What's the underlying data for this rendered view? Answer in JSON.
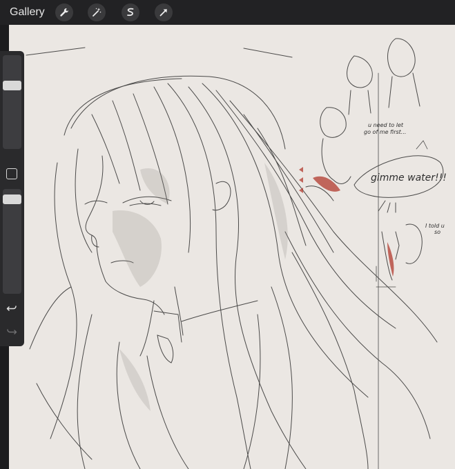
{
  "toolbar": {
    "gallery_label": "Gallery",
    "tools": [
      {
        "name": "wrench-icon"
      },
      {
        "name": "magic-wand-icon"
      },
      {
        "name": "selection-icon"
      },
      {
        "name": "transform-arrow-icon"
      }
    ]
  },
  "sidebar": {
    "brush_size_level": 0.7,
    "opacity_level": 0.94
  },
  "canvas": {
    "notes": [
      "u need to let",
      "go of me first...",
      "gimme water!!!",
      "I told u",
      "so"
    ]
  },
  "colors": {
    "topbar": "#222224",
    "canvas": "#ebe7e3",
    "sketch_stroke": "#2e2e2e",
    "accent_red": "#b23a2e"
  }
}
